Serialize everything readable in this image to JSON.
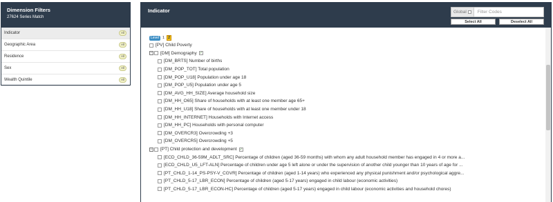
{
  "left": {
    "title": "Dimension Filters",
    "subtitle": "27624 Series Match",
    "items": [
      {
        "label": "Indicator",
        "badge": "All"
      },
      {
        "label": "Geographic Area",
        "badge": "All"
      },
      {
        "label": "Residence",
        "badge": "All"
      },
      {
        "label": "Sex",
        "badge": "All"
      },
      {
        "label": "Wealth Quintile",
        "badge": "All"
      }
    ]
  },
  "right": {
    "title": "Indicator",
    "search": {
      "global_label": "Global",
      "placeholder": "Filter Codes"
    },
    "select_all": "Select All",
    "deselect_all": "Deselect All",
    "level": {
      "label": "Level",
      "options": [
        "1",
        "2"
      ],
      "selected": "2"
    },
    "rows": [
      "[PV] Child Poverty",
      "[DM] Demography",
      "[DM_BRTS] Number of births",
      "[DM_POP_TOT] Total population",
      "[DM_POP_U18] Population under age 18",
      "[DM_POP_U5] Population under age 5",
      "[DM_AVG_HH_SIZE] Average household size",
      "[DM_HH_O65] Share of households with at least one member age 65+",
      "[DM_HH_U18] Share of households with at least one member under 18",
      "[DM_HH_INTERNET] Households with Internet access",
      "[DM_HH_PC] Households with personal computer",
      "[DM_OVERCR3] Overcrowding +3",
      "[DM_OVERCR5] Overcrowding +5",
      "[PT] Child protection and development",
      "[ECD_CHLD_36-59M_ADLT_SRC] Percentage of children (aged 36-59 months) with whom any adult household member has engaged in 4 or more a...",
      "[ECD_CHLD_U5_LFT-ALN] Percentage of children under age 5 left alone or under the supervision of another child younger than 10 years of age for ...",
      "[PT_CHLD_1-14_PS-PSY-V_CGVR] Percentage of children (aged 1-14 years) who experienced any physical punishment and/or psychological aggre...",
      "[PT_CHLD_5-17_LBR_ECON] Percentage of children (aged 5-17 years) engaged in child labour (economic activities)",
      "[PT_CHLD_5-17_LBR_ECON-HC] Percentage of children (aged 5-17 years) engaged in child labour (economic activities and household chores)"
    ]
  }
}
